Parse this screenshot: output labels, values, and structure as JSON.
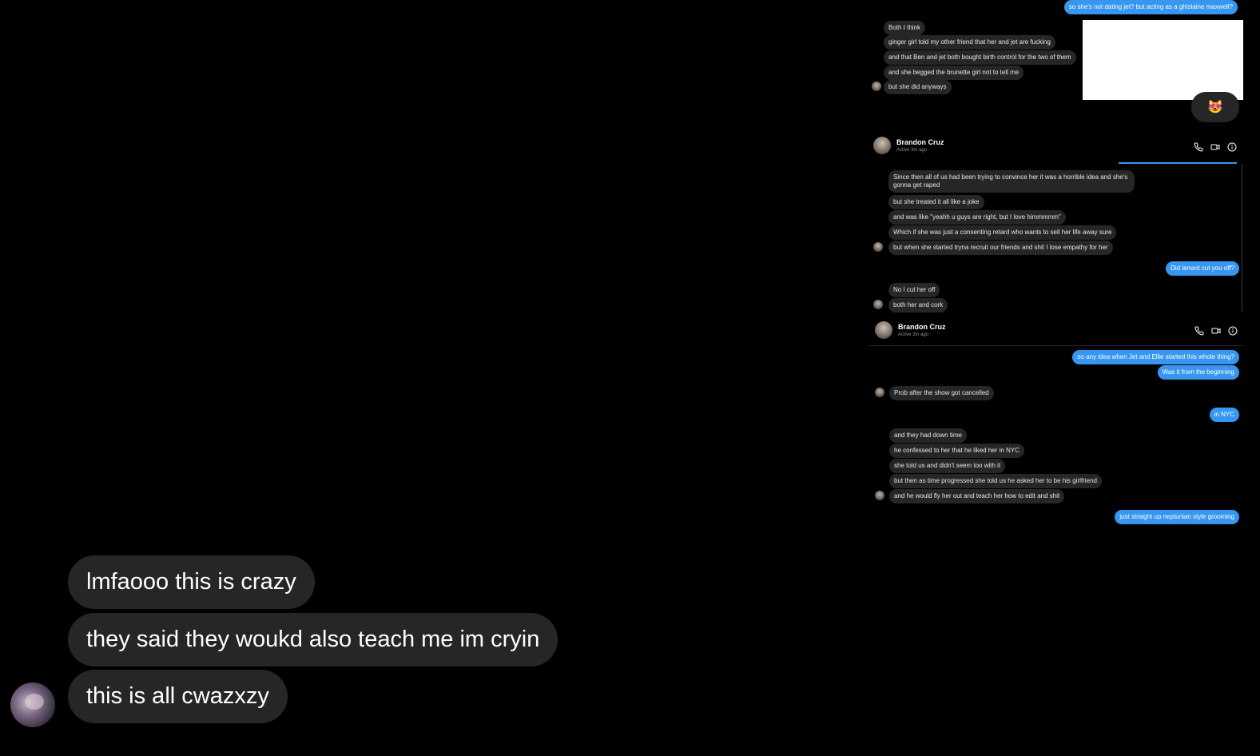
{
  "shot1": {
    "outgoing_top": "so she's not dating jet? but acting as a ghislaine maxwell?",
    "incoming": [
      "Both I think",
      "ginger girl told my other friend that her and jet are fucking",
      "and that Ben and jet both bought birth control for the two of them",
      "and she begged the brunette girl not to tell me",
      "but she did anyways"
    ],
    "reaction_emoji": "😻"
  },
  "shot2": {
    "contact_name": "Brandon Cruz",
    "contact_status": "Active 3m ago",
    "incoming_a": [
      "Since then all of us had been trying to convince her it was a horrible idea and she's gonna get raped",
      "but she treated it all like a joke",
      "and was like \"yeahh u guys are right, but I love himmmmm\"",
      "Which if she was just a consenting retard who wants to sell her life away sure",
      "but when she started tryna recruit our friends and shit I lose empathy for her"
    ],
    "outgoing": "Did lenard cut you off?",
    "incoming_b": [
      "No I cut her off",
      "both her and cork"
    ]
  },
  "shot3": {
    "contact_name": "Brandon Cruz",
    "contact_status": "Active 3m ago",
    "outgoing_a": [
      "so any idea when Jet and Ellie started this whole thing?",
      "Was it from the beginning"
    ],
    "incoming_a": "Prob after the show got cancelled",
    "outgoing_b": "in NYC",
    "incoming_b": [
      "and they had down time",
      "he confessed to her that he liked her in NYC",
      "she told us and didn't seem too with it",
      "but then as time progressed she told us he asked her to be his girlfriend",
      "and he would fly her out and teach her how to edit and shit"
    ],
    "outgoing_c": "just straight up neptunian style grooming"
  },
  "main_chat": {
    "messages": [
      "lmfaooo this is crazy",
      "they said they woukd also teach me im cryin",
      "this is all cwazxzy"
    ]
  },
  "icons": [
    "phone-icon",
    "video-icon",
    "info-icon"
  ]
}
